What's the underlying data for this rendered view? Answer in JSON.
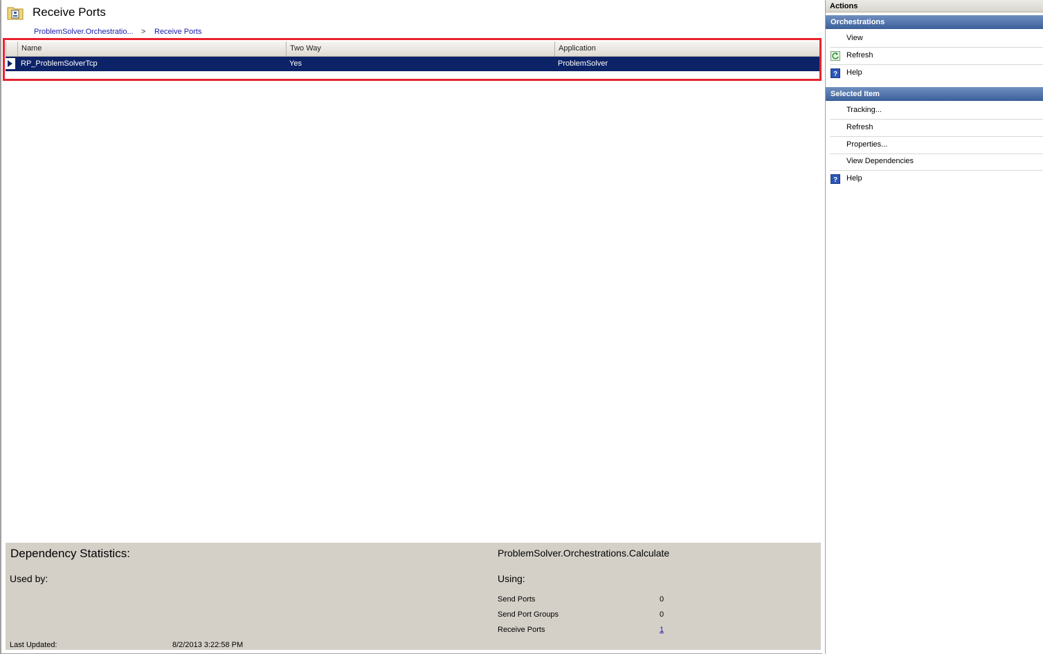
{
  "header": {
    "title": "Receive Ports",
    "breadcrumb": {
      "parent": "ProblemSolver.Orchestratio...",
      "separator": ">",
      "current": "Receive Ports"
    }
  },
  "grid": {
    "columns": [
      "Name",
      "Two Way",
      "Application"
    ],
    "rows": [
      {
        "name": "RP_ProblemSolverTcp",
        "two_way": "Yes",
        "application": "ProblemSolver",
        "selected": true
      }
    ]
  },
  "dependency": {
    "title": "Dependency Statistics:",
    "orchestration": "ProblemSolver.Orchestrations.Calculate",
    "used_by_label": "Used by:",
    "using_label": "Using:",
    "stats": [
      {
        "label": "Send Ports",
        "value": "0"
      },
      {
        "label": "Send Port Groups",
        "value": "0"
      },
      {
        "label": "Receive Ports",
        "value": "1"
      }
    ],
    "last_updated_label": "Last Updated:",
    "last_updated_value": "8/2/2013 3:22:58 PM"
  },
  "actions": {
    "title": "Actions",
    "sections": [
      {
        "title": "Orchestrations",
        "items": [
          "View",
          "Refresh",
          "Help"
        ]
      },
      {
        "title": "Selected Item",
        "items": [
          "Tracking...",
          "Refresh",
          "Properties...",
          "View Dependencies",
          "Help"
        ]
      }
    ]
  },
  "icons": {
    "title": "folder-port-icon",
    "row": "row-selected-arrow-icon",
    "refresh": "refresh-icon",
    "help": "help-icon"
  },
  "colors": {
    "selection": "#0d2367",
    "highlight_border": "#e8222e",
    "section_header": "#3b5f9a",
    "link": "#1a1aa8",
    "panel": "#d4d0c8"
  }
}
